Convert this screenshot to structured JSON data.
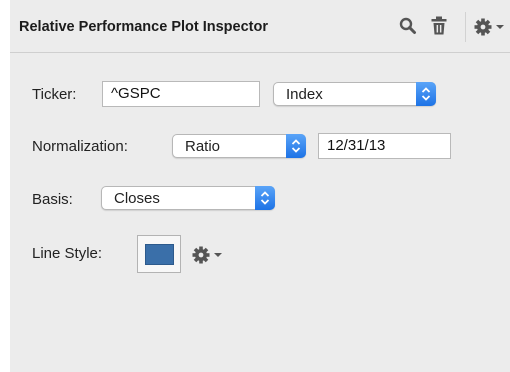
{
  "inspector": {
    "title": "Relative Performance Plot Inspector",
    "icons": {
      "search": "search-icon",
      "trash": "trash-icon",
      "settings": "gear-icon"
    }
  },
  "form": {
    "ticker": {
      "label": "Ticker:",
      "value": "^GSPC",
      "type_selected": "Index"
    },
    "normalization": {
      "label": "Normalization:",
      "method_selected": "Ratio",
      "date_value": "12/31/13"
    },
    "basis": {
      "label": "Basis:",
      "selected": "Closes"
    },
    "line_style": {
      "label": "Line Style:",
      "color": "#3a6fa9"
    }
  },
  "colors": {
    "panel_background": "#ececec",
    "stepper_accent": "#2a84f2",
    "icon_gray": "#5a5a5a"
  }
}
